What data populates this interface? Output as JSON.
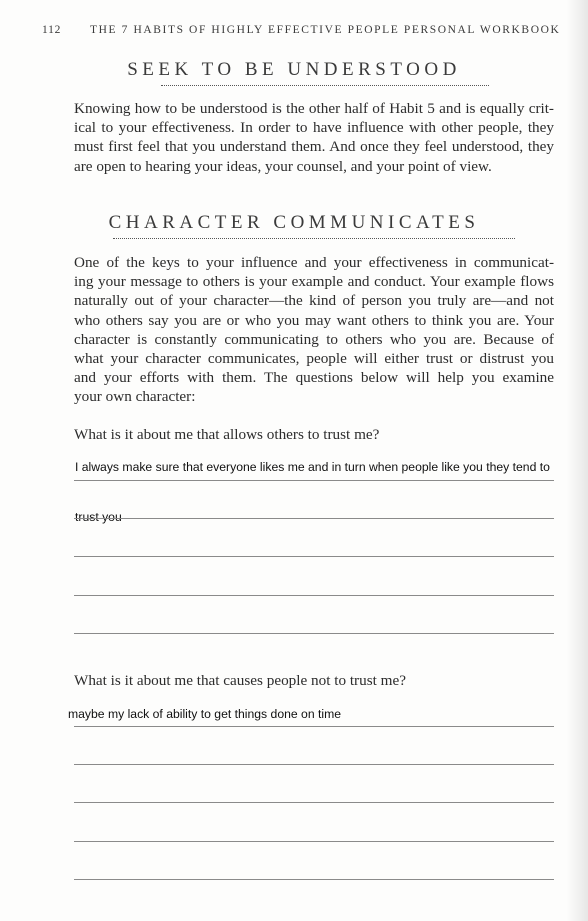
{
  "running_head": {
    "page_number": "112",
    "book_title": "THE 7 HABITS OF HIGHLY EFFECTIVE PEOPLE PERSONAL WORKBOOK"
  },
  "section1": {
    "title": "SEEK TO BE UNDERSTOOD",
    "lines": [
      "Knowing how to be understood is the other half of Habit 5 and is equally crit-",
      "ical to your effectiveness. In order to have influence with other people, they",
      "must first feel that you understand them. And once they feel understood, they",
      "are open to hearing your ideas, your counsel, and your point of view."
    ]
  },
  "section2": {
    "title": "CHARACTER COMMUNICATES",
    "lines": [
      "One of the keys to your influence and your effectiveness in communicat-",
      "ing your message to others is your example and conduct. Your example flows",
      "naturally out of your character—the kind of person you truly are—and not",
      "who others say you are or who you may want others to think you are. Your",
      "character is constantly communicating to others who you are. Because of",
      "what your character communicates, people will either trust or distrust you",
      "and your efforts with them. The questions below will help you examine",
      "your own character:"
    ]
  },
  "question1": {
    "prompt": "What is it about me that allows others to trust me?",
    "answers": [
      "I always make sure that everyone likes me and in turn when people like you they tend to",
      "trust you"
    ]
  },
  "question2": {
    "prompt": "What is it about me that causes people not to trust me?",
    "answers": [
      "maybe my lack of ability to get things done on time"
    ]
  }
}
